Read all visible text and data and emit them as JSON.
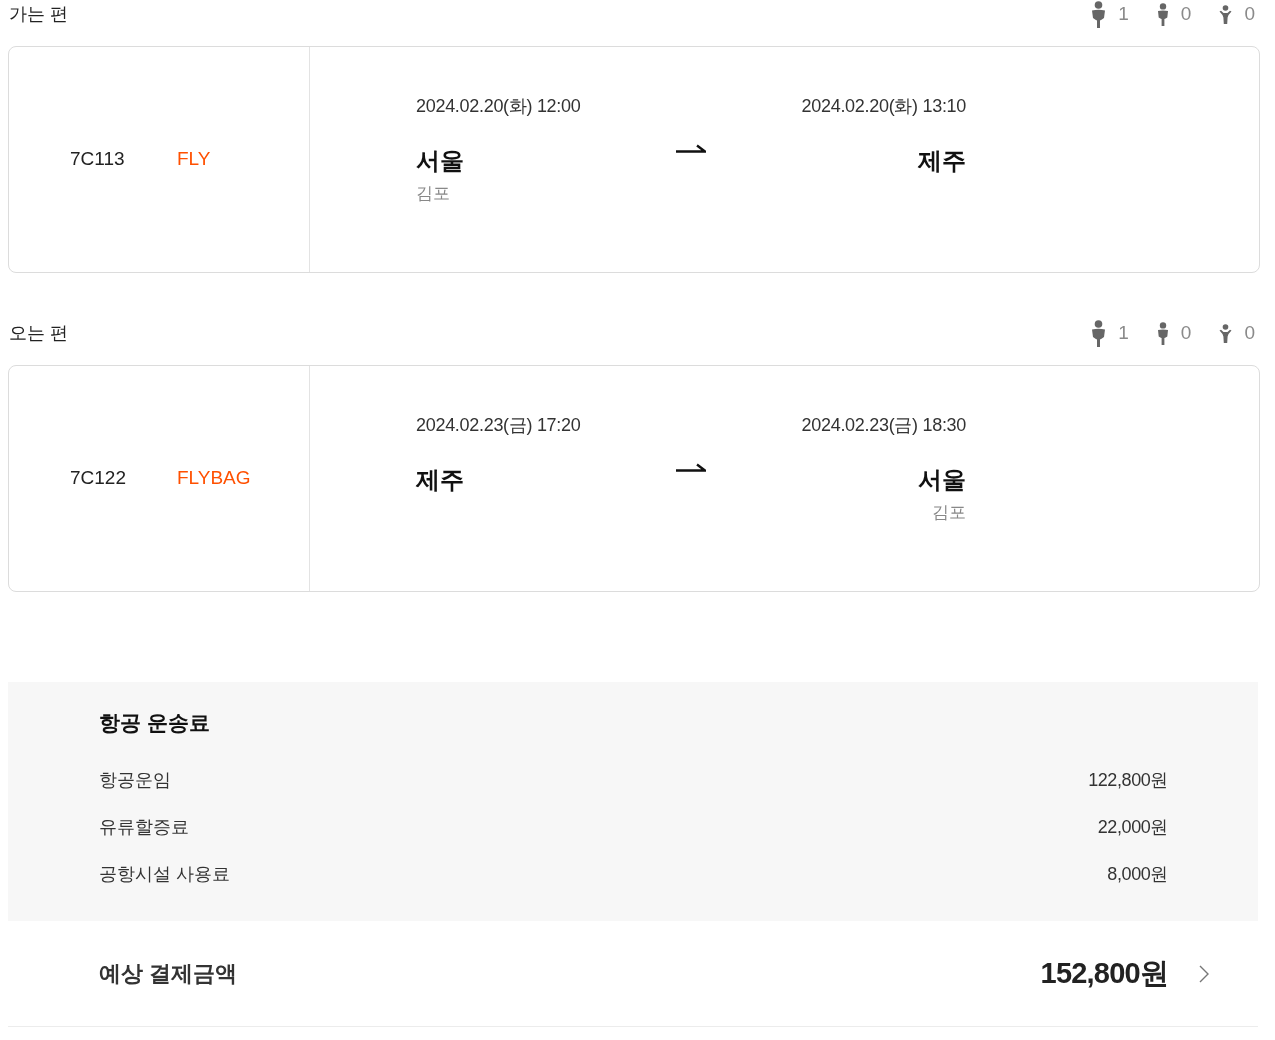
{
  "segments": [
    {
      "title": "가는 편",
      "passengers": [
        {
          "kind": "adult",
          "count": "1"
        },
        {
          "kind": "child",
          "count": "0"
        },
        {
          "kind": "infant",
          "count": "0"
        }
      ],
      "flight_number": "7C113",
      "fare_class": "FLY",
      "departure": {
        "datetime": "2024.02.20(화) 12:00",
        "city": "서울",
        "airport": "김포"
      },
      "arrival": {
        "datetime": "2024.02.20(화) 13:10",
        "city": "제주"
      }
    },
    {
      "title": "오는 편",
      "passengers": [
        {
          "kind": "adult",
          "count": "1"
        },
        {
          "kind": "child",
          "count": "0"
        },
        {
          "kind": "infant",
          "count": "0"
        }
      ],
      "flight_number": "7C122",
      "fare_class": "FLYBAG",
      "departure": {
        "datetime": "2024.02.23(금) 17:20",
        "city": "제주"
      },
      "arrival": {
        "datetime": "2024.02.23(금) 18:30",
        "city": "서울",
        "airport": "김포"
      }
    }
  ],
  "fare": {
    "title": "항공 운송료",
    "items": [
      {
        "label": "항공운임",
        "amount": "122,800원"
      },
      {
        "label": "유류할증료",
        "amount": "22,000원"
      },
      {
        "label": "공항시설 사용료",
        "amount": "8,000원"
      }
    ]
  },
  "total": {
    "label": "예상 결제금액",
    "amount": "152,800원"
  }
}
